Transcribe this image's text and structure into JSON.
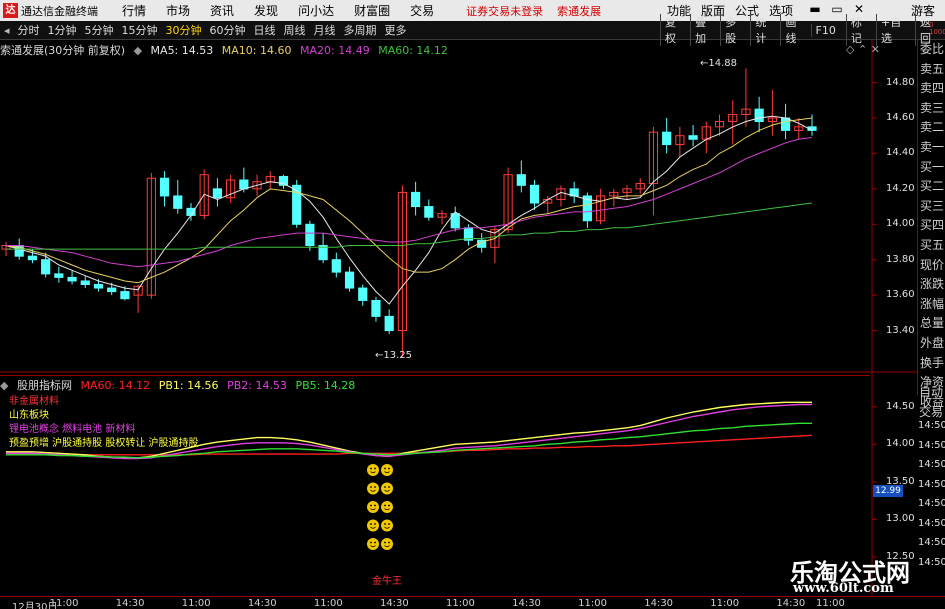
{
  "app": {
    "title": "通达信金融终端",
    "logo": "达",
    "menus": [
      "行情",
      "市场",
      "资讯",
      "发现",
      "问小达",
      "财富圈",
      "交易"
    ],
    "account_status": "证券交易未登录",
    "account_name": "索通发展",
    "right_menus": [
      "功能",
      "版面",
      "公式",
      "选项"
    ],
    "window_controls": [
      "▬",
      "▭",
      "✕"
    ],
    "guest": "游客"
  },
  "toolbar": {
    "periods": [
      "分时",
      "1分钟",
      "5分钟",
      "15分钟",
      "30分钟",
      "60分钟",
      "日线",
      "周线",
      "月线",
      "多周期",
      "更多"
    ],
    "active_period": "30分钟",
    "right_buttons_1": [
      "复权",
      "叠加",
      "多股",
      "统计",
      "画线",
      "F10"
    ],
    "right_buttons_2": [
      "标记",
      "+自选",
      "返回"
    ]
  },
  "main_chart": {
    "header": "索通发展(30分钟 前复权)",
    "ma": [
      {
        "label": "MA5: 14.53",
        "color": "#e8e8e8"
      },
      {
        "label": "MA10: 14.60",
        "color": "#e8d060"
      },
      {
        "label": "MA20: 14.49",
        "color": "#d040d0"
      },
      {
        "label": "MA60: 14.12",
        "color": "#40c040"
      }
    ],
    "high_mark": "14.88",
    "low_mark": "13.25"
  },
  "chart_data": [
    {
      "type": "candlestick",
      "title": "索通发展(30分钟 前复权)",
      "ylim": [
        13.2,
        14.95
      ],
      "y_ticks": [
        "14.80",
        "14.60",
        "14.40",
        "14.20",
        "14.00",
        "13.80",
        "13.60",
        "13.40"
      ],
      "x_ticks": [
        "12月30日",
        "11:00",
        "14:30",
        "11:00",
        "14:30",
        "11:00",
        "14:30",
        "11:00",
        "14:30",
        "11:00",
        "14:30",
        "11:00",
        "14:30",
        "11:00"
      ],
      "ohlc": [
        [
          13.86,
          13.9,
          13.82,
          13.88
        ],
        [
          13.88,
          13.92,
          13.8,
          13.82
        ],
        [
          13.82,
          13.86,
          13.78,
          13.8
        ],
        [
          13.8,
          13.84,
          13.7,
          13.72
        ],
        [
          13.72,
          13.76,
          13.67,
          13.7
        ],
        [
          13.7,
          13.74,
          13.66,
          13.68
        ],
        [
          13.68,
          13.71,
          13.64,
          13.66
        ],
        [
          13.66,
          13.69,
          13.62,
          13.64
        ],
        [
          13.64,
          13.67,
          13.6,
          13.62
        ],
        [
          13.62,
          13.65,
          13.57,
          13.58
        ],
        [
          13.6,
          13.66,
          13.5,
          13.65
        ],
        [
          13.6,
          14.29,
          13.58,
          14.26
        ],
        [
          14.26,
          14.3,
          14.1,
          14.16
        ],
        [
          14.16,
          14.25,
          14.06,
          14.09
        ],
        [
          14.09,
          14.12,
          14.02,
          14.05
        ],
        [
          14.05,
          14.31,
          14.03,
          14.28
        ],
        [
          14.2,
          14.26,
          14.1,
          14.15
        ],
        [
          14.15,
          14.28,
          14.12,
          14.25
        ],
        [
          14.25,
          14.32,
          14.18,
          14.2
        ],
        [
          14.2,
          14.28,
          14.16,
          14.24
        ],
        [
          14.24,
          14.3,
          14.2,
          14.27
        ],
        [
          14.27,
          14.28,
          14.2,
          14.22
        ],
        [
          14.22,
          14.25,
          13.98,
          14.0
        ],
        [
          14.0,
          14.02,
          13.85,
          13.88
        ],
        [
          13.88,
          13.95,
          13.78,
          13.8
        ],
        [
          13.8,
          13.84,
          13.7,
          13.73
        ],
        [
          13.73,
          13.76,
          13.62,
          13.64
        ],
        [
          13.64,
          13.66,
          13.54,
          13.57
        ],
        [
          13.57,
          13.59,
          13.45,
          13.48
        ],
        [
          13.48,
          13.52,
          13.38,
          13.4
        ],
        [
          13.4,
          14.22,
          13.25,
          14.18
        ],
        [
          14.18,
          14.24,
          14.05,
          14.1
        ],
        [
          14.1,
          14.14,
          14.02,
          14.04
        ],
        [
          14.04,
          14.08,
          14.0,
          14.06
        ],
        [
          14.06,
          14.1,
          13.96,
          13.98
        ],
        [
          13.98,
          14.0,
          13.88,
          13.91
        ],
        [
          13.91,
          13.95,
          13.84,
          13.87
        ],
        [
          13.87,
          13.99,
          13.78,
          13.97
        ],
        [
          13.97,
          14.32,
          13.95,
          14.28
        ],
        [
          14.28,
          14.36,
          14.18,
          14.22
        ],
        [
          14.22,
          14.25,
          14.08,
          14.12
        ],
        [
          14.12,
          14.16,
          14.06,
          14.14
        ],
        [
          14.14,
          14.22,
          14.1,
          14.2
        ],
        [
          14.2,
          14.24,
          14.12,
          14.16
        ],
        [
          14.16,
          14.18,
          13.98,
          14.02
        ],
        [
          14.02,
          14.2,
          14.0,
          14.16
        ],
        [
          14.16,
          14.2,
          14.1,
          14.18
        ],
        [
          14.18,
          14.22,
          14.14,
          14.2
        ],
        [
          14.2,
          14.26,
          14.17,
          14.23
        ],
        [
          14.23,
          14.55,
          14.05,
          14.52
        ],
        [
          14.52,
          14.6,
          14.4,
          14.45
        ],
        [
          14.45,
          14.55,
          14.38,
          14.5
        ],
        [
          14.5,
          14.56,
          14.44,
          14.48
        ],
        [
          14.48,
          14.58,
          14.4,
          14.55
        ],
        [
          14.55,
          14.62,
          14.5,
          14.58
        ],
        [
          14.58,
          14.7,
          14.45,
          14.62
        ],
        [
          14.62,
          14.88,
          14.55,
          14.65
        ],
        [
          14.65,
          14.72,
          14.52,
          14.58
        ],
        [
          14.58,
          14.76,
          14.5,
          14.6
        ],
        [
          14.6,
          14.68,
          14.48,
          14.53
        ],
        [
          14.53,
          14.6,
          14.48,
          14.55
        ],
        [
          14.55,
          14.62,
          14.5,
          14.53
        ]
      ],
      "series": [
        {
          "name": "MA5",
          "color": "#e8e8e8",
          "values": [
            13.88,
            13.86,
            13.84,
            13.82,
            13.77,
            13.74,
            13.71,
            13.68,
            13.66,
            13.64,
            13.63,
            13.75,
            13.86,
            13.95,
            14.05,
            14.17,
            14.14,
            14.17,
            14.2,
            14.22,
            14.24,
            14.23,
            14.19,
            14.13,
            14.04,
            13.92,
            13.81,
            13.71,
            13.62,
            13.55,
            13.65,
            13.74,
            13.84,
            13.97,
            14.07,
            14.02,
            13.97,
            13.95,
            14.0,
            14.05,
            14.09,
            14.14,
            14.18,
            14.16,
            14.14,
            14.13,
            14.15,
            14.14,
            14.15,
            14.24,
            14.3,
            14.38,
            14.43,
            14.48,
            14.51,
            14.55,
            14.58,
            14.6,
            14.61,
            14.6,
            14.57,
            14.53
          ]
        },
        {
          "name": "MA10",
          "color": "#e8d060",
          "values": [
            13.88,
            13.87,
            13.85,
            13.83,
            13.8,
            13.77,
            13.74,
            13.72,
            13.7,
            13.68,
            13.67,
            13.7,
            13.73,
            13.77,
            13.81,
            13.86,
            13.94,
            14.02,
            14.08,
            14.15,
            14.2,
            14.19,
            14.18,
            14.16,
            14.14,
            14.08,
            14.02,
            13.95,
            13.88,
            13.81,
            13.75,
            13.73,
            13.73,
            13.75,
            13.8,
            13.86,
            13.9,
            13.92,
            13.98,
            14.03,
            14.05,
            14.06,
            14.08,
            14.1,
            14.11,
            14.13,
            14.15,
            14.16,
            14.16,
            14.19,
            14.22,
            14.27,
            14.31,
            14.34,
            14.4,
            14.44,
            14.49,
            14.53,
            14.56,
            14.58,
            14.59,
            14.6
          ]
        },
        {
          "name": "MA20",
          "color": "#d040d0",
          "values": [
            13.88,
            13.88,
            13.87,
            13.86,
            13.85,
            13.84,
            13.82,
            13.8,
            13.78,
            13.77,
            13.76,
            13.77,
            13.78,
            13.79,
            13.81,
            13.83,
            13.85,
            13.88,
            13.9,
            13.92,
            13.93,
            13.94,
            13.95,
            13.95,
            13.95,
            13.94,
            13.93,
            13.92,
            13.91,
            13.9,
            13.9,
            13.91,
            13.93,
            13.95,
            13.97,
            13.98,
            13.98,
            13.99,
            14.0,
            14.02,
            14.04,
            14.05,
            14.06,
            14.07,
            14.07,
            14.08,
            14.09,
            14.1,
            14.12,
            14.14,
            14.17,
            14.2,
            14.23,
            14.26,
            14.29,
            14.33,
            14.37,
            14.4,
            14.43,
            14.46,
            14.48,
            14.49
          ]
        },
        {
          "name": "MA60",
          "color": "#40c040",
          "values": [
            13.86,
            13.86,
            13.86,
            13.86,
            13.86,
            13.86,
            13.86,
            13.86,
            13.86,
            13.86,
            13.86,
            13.86,
            13.86,
            13.86,
            13.86,
            13.87,
            13.87,
            13.87,
            13.87,
            13.87,
            13.87,
            13.87,
            13.87,
            13.87,
            13.87,
            13.87,
            13.88,
            13.88,
            13.88,
            13.88,
            13.88,
            13.89,
            13.89,
            13.9,
            13.91,
            13.92,
            13.92,
            13.93,
            13.94,
            13.94,
            13.95,
            13.95,
            13.96,
            13.96,
            13.97,
            13.97,
            13.98,
            13.98,
            13.99,
            14.0,
            14.01,
            14.02,
            14.03,
            14.04,
            14.05,
            14.06,
            14.07,
            14.08,
            14.09,
            14.1,
            14.11,
            14.12
          ]
        }
      ]
    },
    {
      "type": "line",
      "title": "股朋指标网",
      "ylim": [
        12.3,
        14.75
      ],
      "y_ticks": [
        "14.50",
        "14.00",
        "13.50",
        "13.00",
        "12.50"
      ],
      "series": [
        {
          "name": "MA60",
          "color": "#ff2020",
          "values": [
            13.86,
            13.86,
            13.86,
            13.86,
            13.86,
            13.86,
            13.86,
            13.86,
            13.86,
            13.86,
            13.86,
            13.86,
            13.86,
            13.86,
            13.86,
            13.87,
            13.87,
            13.87,
            13.87,
            13.87,
            13.87,
            13.87,
            13.87,
            13.87,
            13.87,
            13.87,
            13.88,
            13.88,
            13.88,
            13.88,
            13.88,
            13.89,
            13.89,
            13.9,
            13.91,
            13.92,
            13.92,
            13.93,
            13.94,
            13.94,
            13.95,
            13.95,
            13.96,
            13.96,
            13.97,
            13.97,
            13.98,
            13.98,
            13.99,
            14.0,
            14.01,
            14.02,
            14.03,
            14.04,
            14.05,
            14.06,
            14.07,
            14.08,
            14.09,
            14.1,
            14.11,
            14.12
          ]
        },
        {
          "name": "PB1",
          "color": "#ffff60",
          "values": [
            13.9,
            13.9,
            13.9,
            13.89,
            13.88,
            13.87,
            13.86,
            13.84,
            13.83,
            13.82,
            13.82,
            13.84,
            13.88,
            13.92,
            13.96,
            14.0,
            14.03,
            14.05,
            14.07,
            14.09,
            14.09,
            14.08,
            14.06,
            14.03,
            13.99,
            13.95,
            13.91,
            13.88,
            13.85,
            13.84,
            13.88,
            13.91,
            13.94,
            13.97,
            14.0,
            14.01,
            14.02,
            14.03,
            14.05,
            14.07,
            14.09,
            14.11,
            14.13,
            14.15,
            14.16,
            14.18,
            14.2,
            14.22,
            14.25,
            14.3,
            14.35,
            14.39,
            14.43,
            14.46,
            14.49,
            14.51,
            14.53,
            14.54,
            14.55,
            14.56,
            14.56,
            14.56
          ]
        },
        {
          "name": "PB2",
          "color": "#e040e0",
          "values": [
            13.88,
            13.88,
            13.88,
            13.87,
            13.86,
            13.85,
            13.84,
            13.83,
            13.82,
            13.81,
            13.81,
            13.82,
            13.85,
            13.88,
            13.91,
            13.94,
            13.97,
            13.99,
            14.01,
            14.02,
            14.02,
            14.02,
            14.01,
            13.99,
            13.96,
            13.93,
            13.9,
            13.87,
            13.85,
            13.84,
            13.86,
            13.88,
            13.9,
            13.92,
            13.95,
            13.96,
            13.97,
            13.98,
            14.0,
            14.02,
            14.04,
            14.06,
            14.08,
            14.1,
            14.12,
            14.14,
            14.16,
            14.18,
            14.21,
            14.25,
            14.29,
            14.33,
            14.37,
            14.4,
            14.43,
            14.46,
            14.48,
            14.5,
            14.51,
            14.52,
            14.53,
            14.53
          ]
        },
        {
          "name": "PB5",
          "color": "#30e030",
          "values": [
            13.86,
            13.86,
            13.86,
            13.86,
            13.85,
            13.85,
            13.84,
            13.84,
            13.83,
            13.83,
            13.82,
            13.83,
            13.84,
            13.85,
            13.87,
            13.88,
            13.9,
            13.91,
            13.92,
            13.93,
            13.94,
            13.94,
            13.94,
            13.93,
            13.92,
            13.91,
            13.89,
            13.88,
            13.87,
            13.86,
            13.87,
            13.88,
            13.89,
            13.9,
            13.92,
            13.93,
            13.94,
            13.95,
            13.96,
            13.97,
            13.98,
            14.0,
            14.01,
            14.03,
            14.04,
            14.06,
            14.07,
            14.09,
            14.1,
            14.12,
            14.14,
            14.16,
            14.18,
            14.19,
            14.21,
            14.22,
            14.24,
            14.25,
            14.26,
            14.27,
            14.28,
            14.28
          ]
        }
      ]
    }
  ],
  "indicator": {
    "name": "股朋指标网",
    "values": [
      {
        "label": "MA60: 14.12",
        "color": "#ff2020"
      },
      {
        "label": "PB1: 14.56",
        "color": "#ffff60"
      },
      {
        "label": "PB2: 14.53",
        "color": "#e040e0"
      },
      {
        "label": "PB5: 14.28",
        "color": "#30e030"
      }
    ],
    "hot_lines": [
      {
        "text": "非金属材料",
        "color": "#ff3030"
      },
      {
        "text": "山东板块",
        "color": "#ffff40"
      },
      {
        "text": "锂电池概念 燃料电池 新材料",
        "color": "#e040e0"
      },
      {
        "text": "预盈预增 沪股通持股 股权转让 沪股通持股",
        "color": "#ffff40"
      }
    ],
    "signal_label": "金牛王",
    "signal_count": 10,
    "price_tag": "12.99"
  },
  "sidebar": [
    "委比",
    "卖五",
    "卖四",
    "卖三",
    "卖二",
    "卖一",
    "买一",
    "买二",
    "买三",
    "买四",
    "买五",
    "现价",
    "涨跌",
    "涨幅",
    "总量",
    "外盘",
    "换手",
    "净资",
    "收益"
  ],
  "sidebar_bottom": [
    "自动",
    "交易"
  ],
  "sidebar_small": "0 1000",
  "lower_axis_right": [
    "14:50",
    "14:50",
    "14:50",
    "14:50",
    "14:50",
    "14:50",
    "14:50",
    "14:50"
  ],
  "watermark": {
    "line1": "乐淘公式网",
    "line2": "www.60lt.com"
  }
}
